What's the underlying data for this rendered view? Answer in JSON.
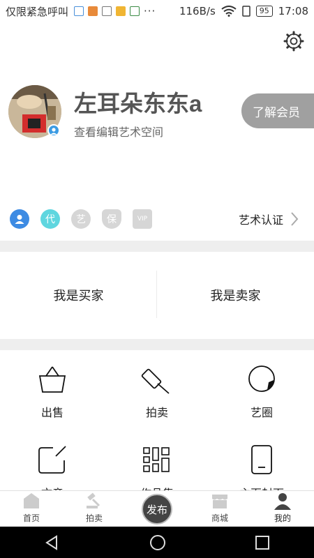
{
  "status_bar": {
    "carrier": "仅限紧急呼叫",
    "dots": "···",
    "speed": "116B/s",
    "battery": "95",
    "time": "17:08"
  },
  "profile": {
    "username": "左耳朵东东a",
    "subtitle": "查看编辑艺术空间",
    "member_button": "了解会员"
  },
  "badges": [
    {
      "icon": "user-icon",
      "label": ""
    },
    {
      "icon": "dai-badge",
      "label": "代"
    },
    {
      "icon": "yi-badge",
      "label": "艺"
    },
    {
      "icon": "bao-badge",
      "label": "保"
    },
    {
      "icon": "vip-badge",
      "label": "VIP"
    }
  ],
  "art_cert": {
    "label": "艺术认证"
  },
  "roles": {
    "buyer": "我是买家",
    "seller": "我是卖家"
  },
  "grid": [
    {
      "icon": "basket-icon",
      "label": "出售"
    },
    {
      "icon": "gavel-icon",
      "label": "拍卖"
    },
    {
      "icon": "circle-icon",
      "label": "艺圈"
    },
    {
      "icon": "edit-icon",
      "label": "文章"
    },
    {
      "icon": "grid-icon",
      "label": "作品集"
    },
    {
      "icon": "tablet-icon",
      "label": "主页封面"
    }
  ],
  "bottom_nav": {
    "home": "首页",
    "auction": "拍卖",
    "publish": "发布",
    "mall": "商城",
    "mine": "我的"
  },
  "colors": {
    "accent": "#3d8be3",
    "badge_cyan": "#5fd6df",
    "member_bg": "#a0a0a0"
  }
}
